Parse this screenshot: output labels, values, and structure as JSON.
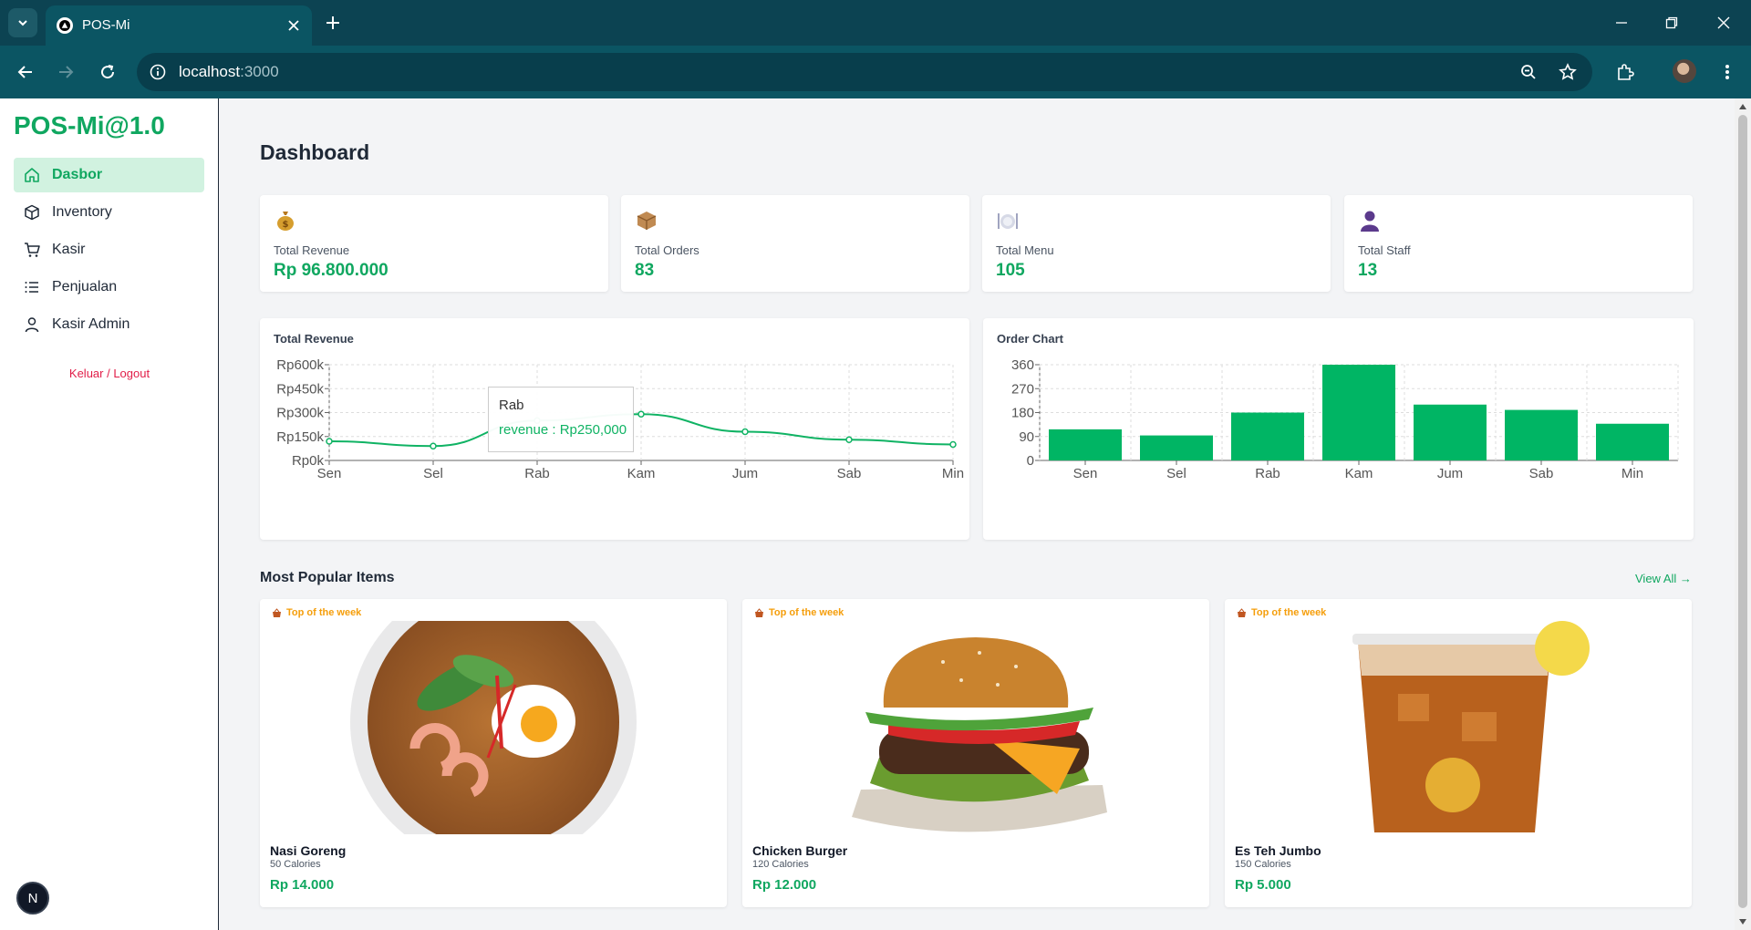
{
  "browser": {
    "tab_title": "POS-Mi",
    "url_host": "localhost",
    "url_port": ":3000"
  },
  "sidebar": {
    "brand": "POS-Mi@1.0",
    "items": [
      {
        "label": "Dasbor",
        "icon": "home-icon",
        "active": true
      },
      {
        "label": "Inventory",
        "icon": "box-icon",
        "active": false
      },
      {
        "label": "Kasir",
        "icon": "cart-icon",
        "active": false
      },
      {
        "label": "Penjualan",
        "icon": "list-icon",
        "active": false
      },
      {
        "label": "Kasir Admin",
        "icon": "user-icon",
        "active": false
      }
    ],
    "logout": "Keluar / Logout",
    "dev_badge": "N"
  },
  "dashboard": {
    "title": "Dashboard",
    "stats": [
      {
        "icon": "money-bag-icon",
        "label": "Total Revenue",
        "value": "Rp 96.800.000"
      },
      {
        "icon": "package-icon",
        "label": "Total Orders",
        "value": "83"
      },
      {
        "icon": "plate-icon",
        "label": "Total Menu",
        "value": "105"
      },
      {
        "icon": "staff-icon",
        "label": "Total Staff",
        "value": "13"
      }
    ],
    "revenue_chart_title": "Total Revenue",
    "order_chart_title": "Order Chart",
    "tooltip": {
      "title": "Rab",
      "text": "revenue : Rp250,000"
    },
    "popular": {
      "title": "Most Popular Items",
      "view_all": "View All →",
      "items": [
        {
          "badge": "Top of the week",
          "name": "Nasi Goreng",
          "calories": "50 Calories",
          "price": "Rp 14.000"
        },
        {
          "badge": "Top of the week",
          "name": "Chicken Burger",
          "calories": "120 Calories",
          "price": "Rp 12.000"
        },
        {
          "badge": "Top of the week",
          "name": "Es Teh Jumbo",
          "calories": "150 Calories",
          "price": "Rp 5.000"
        }
      ]
    }
  },
  "colors": {
    "accent": "#10b364",
    "brand": "#10a760",
    "danger": "#e11d48"
  },
  "chart_data": [
    {
      "type": "line",
      "title": "Total Revenue",
      "categories": [
        "Sen",
        "Sel",
        "Rab",
        "Kam",
        "Jum",
        "Sab",
        "Min"
      ],
      "series": [
        {
          "name": "revenue",
          "values": [
            120000,
            90000,
            250000,
            290000,
            180000,
            130000,
            100000
          ]
        }
      ],
      "ylim": [
        0,
        600000
      ],
      "yticks": [
        0,
        150000,
        300000,
        450000,
        600000
      ],
      "ytick_labels": [
        "Rp0k",
        "Rp150k",
        "Rp300k",
        "Rp450k",
        "Rp600k"
      ],
      "grid": true
    },
    {
      "type": "bar",
      "title": "Order Chart",
      "categories": [
        "Sen",
        "Sel",
        "Rab",
        "Kam",
        "Jum",
        "Sab",
        "Min"
      ],
      "values": [
        117,
        94,
        180,
        360,
        210,
        190,
        138
      ],
      "ylim": [
        0,
        360
      ],
      "yticks": [
        0,
        90,
        180,
        270,
        360
      ],
      "ytick_labels": [
        "0",
        "90",
        "180",
        "270",
        "360"
      ],
      "grid": true
    }
  ]
}
